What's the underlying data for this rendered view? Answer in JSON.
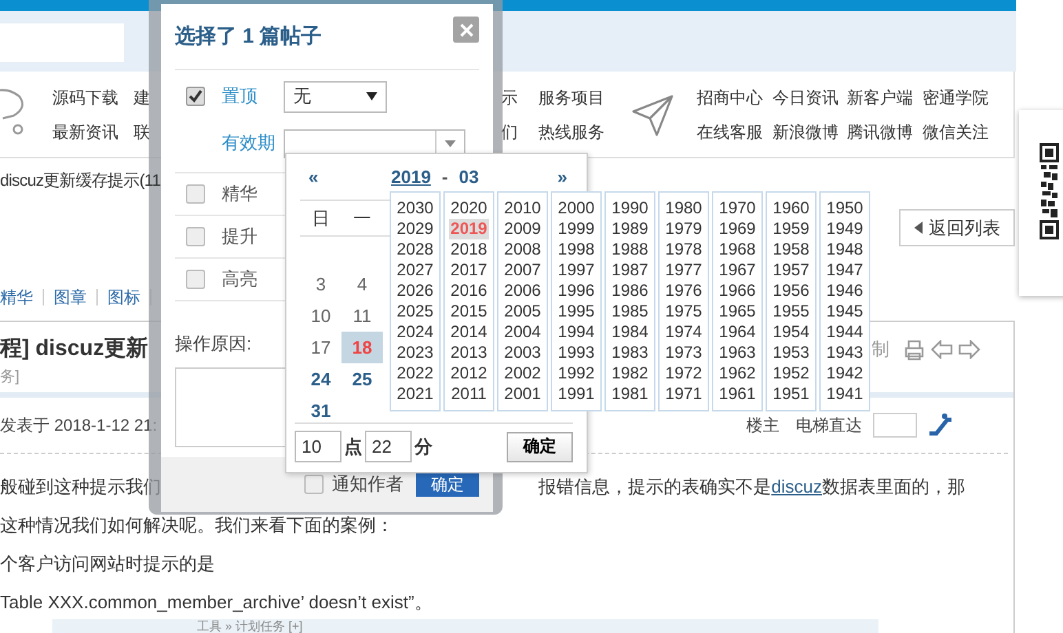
{
  "nav": {
    "left_rows": [
      [
        "源码下载",
        "建",
        "示",
        "服务项目"
      ],
      [
        "最新资讯",
        "联",
        "们",
        "热线服务"
      ]
    ],
    "right_rows": [
      [
        "招商中心",
        "今日资讯",
        "新客户端",
        "密通学院"
      ],
      [
        "在线客服",
        "新浪微博",
        "腾讯微博",
        "微信关注"
      ]
    ]
  },
  "breadcrumb": "discuz更新缓存提示(11",
  "back_button": "返回列表",
  "post_tabs": [
    "精华",
    "图章",
    "图标"
  ],
  "post": {
    "title": "程] discuz更新",
    "subtitle": "务]",
    "side_text": "制",
    "posted": "发表于 2018-1-12 21:",
    "author_label": "楼主",
    "jump_label": "电梯直达",
    "paragraphs": [
      {
        "left": "般碰到这种提示我们",
        "right": "报错信息，提示的表确实不是",
        "link": "discuz",
        "after": "数据表里面的，那"
      },
      {
        "left": "这种情况我们如何解决呢。我们来看下面的案例："
      },
      {
        "left": "个客户访问网站时提示的是"
      },
      {
        "left": "Table XXX.common_member_archive’ doesn’t exist”。"
      }
    ],
    "strip_text": "工具 » 计划任务 [+]"
  },
  "dialog": {
    "title": "选择了 1 篇帖子",
    "options": [
      {
        "kind": "sticky",
        "label": "置顶",
        "checked": true,
        "value": "无",
        "expiry_label": "有效期"
      },
      {
        "kind": "plain",
        "label": "精华",
        "checked": false
      },
      {
        "kind": "plain",
        "label": "提升",
        "checked": false
      },
      {
        "kind": "plain",
        "label": "高亮",
        "checked": false
      }
    ],
    "reason_label": "操作原因:",
    "notify": {
      "label": "通知作者",
      "checked": false
    },
    "submit": "确定"
  },
  "calendar": {
    "prev": "«",
    "year": "2019",
    "sep": "-",
    "month": "03",
    "next": "»",
    "weekdays": [
      "日",
      "一"
    ],
    "weeks": [
      [
        {
          "day": "3",
          "kind": "normal"
        },
        {
          "day": "4",
          "kind": "normal"
        }
      ],
      [
        {
          "day": "10",
          "kind": "normal"
        },
        {
          "day": "11",
          "kind": "normal"
        }
      ],
      [
        {
          "day": "17",
          "kind": "normal"
        },
        {
          "day": "18",
          "kind": "today"
        }
      ],
      [
        {
          "day": "24",
          "kind": "bold"
        },
        {
          "day": "25",
          "kind": "bold"
        }
      ],
      [
        {
          "day": "31",
          "kind": "bold"
        }
      ]
    ],
    "hour": "10",
    "hour_unit": "点",
    "minute": "22",
    "minute_unit": "分",
    "ok": "确定"
  },
  "year_picker": {
    "columns": [
      [
        {
          "year": "2030",
          "selected": false
        },
        {
          "year": "2029",
          "selected": false
        },
        {
          "year": "2028",
          "selected": false
        },
        {
          "year": "2027",
          "selected": false
        },
        {
          "year": "2026",
          "selected": false
        },
        {
          "year": "2025",
          "selected": false
        },
        {
          "year": "2024",
          "selected": false
        },
        {
          "year": "2023",
          "selected": false
        },
        {
          "year": "2022",
          "selected": false
        },
        {
          "year": "2021",
          "selected": false
        }
      ],
      [
        {
          "year": "2020",
          "selected": false
        },
        {
          "year": "2019",
          "selected": true
        },
        {
          "year": "2018",
          "selected": false
        },
        {
          "year": "2017",
          "selected": false
        },
        {
          "year": "2016",
          "selected": false
        },
        {
          "year": "2015",
          "selected": false
        },
        {
          "year": "2014",
          "selected": false
        },
        {
          "year": "2013",
          "selected": false
        },
        {
          "year": "2012",
          "selected": false
        },
        {
          "year": "2011",
          "selected": false
        }
      ],
      [
        {
          "year": "2010",
          "selected": false
        },
        {
          "year": "2009",
          "selected": false
        },
        {
          "year": "2008",
          "selected": false
        },
        {
          "year": "2007",
          "selected": false
        },
        {
          "year": "2006",
          "selected": false
        },
        {
          "year": "2005",
          "selected": false
        },
        {
          "year": "2004",
          "selected": false
        },
        {
          "year": "2003",
          "selected": false
        },
        {
          "year": "2002",
          "selected": false
        },
        {
          "year": "2001",
          "selected": false
        }
      ],
      [
        {
          "year": "2000",
          "selected": false
        },
        {
          "year": "1999",
          "selected": false
        },
        {
          "year": "1998",
          "selected": false
        },
        {
          "year": "1997",
          "selected": false
        },
        {
          "year": "1996",
          "selected": false
        },
        {
          "year": "1995",
          "selected": false
        },
        {
          "year": "1994",
          "selected": false
        },
        {
          "year": "1993",
          "selected": false
        },
        {
          "year": "1992",
          "selected": false
        },
        {
          "year": "1991",
          "selected": false
        }
      ],
      [
        {
          "year": "1990",
          "selected": false
        },
        {
          "year": "1989",
          "selected": false
        },
        {
          "year": "1988",
          "selected": false
        },
        {
          "year": "1987",
          "selected": false
        },
        {
          "year": "1986",
          "selected": false
        },
        {
          "year": "1985",
          "selected": false
        },
        {
          "year": "1984",
          "selected": false
        },
        {
          "year": "1983",
          "selected": false
        },
        {
          "year": "1982",
          "selected": false
        },
        {
          "year": "1981",
          "selected": false
        }
      ],
      [
        {
          "year": "1980",
          "selected": false
        },
        {
          "year": "1979",
          "selected": false
        },
        {
          "year": "1978",
          "selected": false
        },
        {
          "year": "1977",
          "selected": false
        },
        {
          "year": "1976",
          "selected": false
        },
        {
          "year": "1975",
          "selected": false
        },
        {
          "year": "1974",
          "selected": false
        },
        {
          "year": "1973",
          "selected": false
        },
        {
          "year": "1972",
          "selected": false
        },
        {
          "year": "1971",
          "selected": false
        }
      ],
      [
        {
          "year": "1970",
          "selected": false
        },
        {
          "year": "1969",
          "selected": false
        },
        {
          "year": "1968",
          "selected": false
        },
        {
          "year": "1967",
          "selected": false
        },
        {
          "year": "1966",
          "selected": false
        },
        {
          "year": "1965",
          "selected": false
        },
        {
          "year": "1964",
          "selected": false
        },
        {
          "year": "1963",
          "selected": false
        },
        {
          "year": "1962",
          "selected": false
        },
        {
          "year": "1961",
          "selected": false
        }
      ],
      [
        {
          "year": "1960",
          "selected": false
        },
        {
          "year": "1959",
          "selected": false
        },
        {
          "year": "1958",
          "selected": false
        },
        {
          "year": "1957",
          "selected": false
        },
        {
          "year": "1956",
          "selected": false
        },
        {
          "year": "1955",
          "selected": false
        },
        {
          "year": "1954",
          "selected": false
        },
        {
          "year": "1953",
          "selected": false
        },
        {
          "year": "1952",
          "selected": false
        },
        {
          "year": "1951",
          "selected": false
        }
      ],
      [
        {
          "year": "1950",
          "selected": false
        },
        {
          "year": "1949",
          "selected": false
        },
        {
          "year": "1948",
          "selected": false
        },
        {
          "year": "1947",
          "selected": false
        },
        {
          "year": "1946",
          "selected": false
        },
        {
          "year": "1945",
          "selected": false
        },
        {
          "year": "1944",
          "selected": false
        },
        {
          "year": "1943",
          "selected": false
        },
        {
          "year": "1942",
          "selected": false
        },
        {
          "year": "1941",
          "selected": false
        }
      ]
    ]
  }
}
